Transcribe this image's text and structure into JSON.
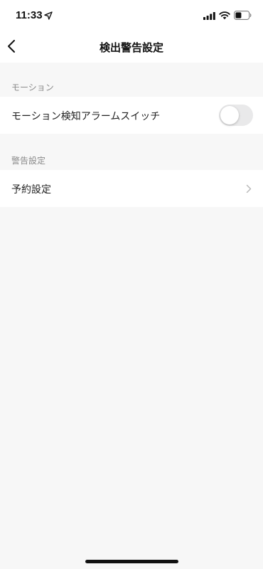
{
  "status_bar": {
    "time": "11:33"
  },
  "nav": {
    "title": "検出警告設定"
  },
  "sections": [
    {
      "header": "モーション",
      "row_label": "モーション検知アラームスイッチ",
      "toggle_on": false
    },
    {
      "header": "警告設定",
      "row_label": "予約設定"
    }
  ],
  "colors": {
    "background": "#f7f7f7",
    "row": "#ffffff",
    "section_header": "#8a8a8a",
    "toggle_off": "#e9e9ea"
  }
}
